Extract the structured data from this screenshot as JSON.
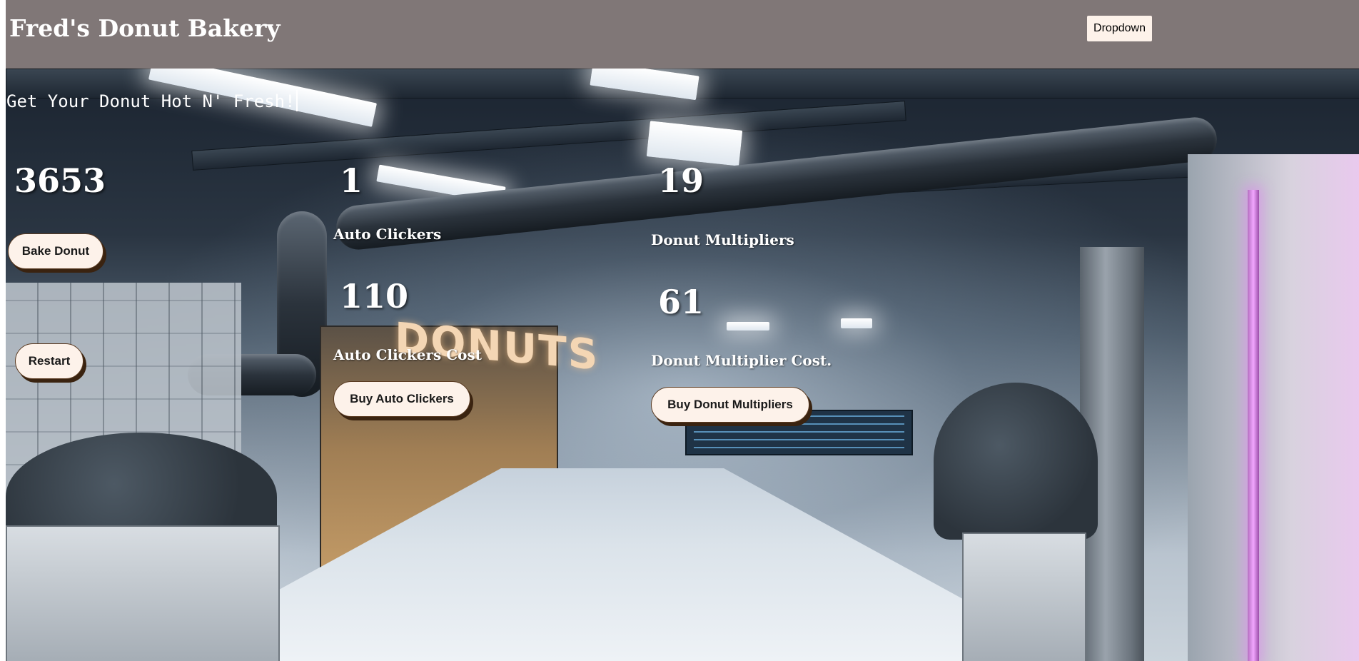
{
  "header": {
    "title": "Fred's Donut Bakery",
    "dropdown_label": "Dropdown"
  },
  "tagline": "Get Your Donut Hot N' Fresh!",
  "donuts": {
    "count": "3653",
    "bake_label": "Bake Donut",
    "restart_label": "Restart"
  },
  "auto_clickers": {
    "count": "1",
    "count_label": "Auto Clickers",
    "cost": "110",
    "cost_label": "Auto Clickers Cost",
    "buy_label": "Buy Auto Clickers"
  },
  "multipliers": {
    "count": "19",
    "count_label": "Donut Multipliers",
    "cost": "61",
    "cost_label": "Donut Multiplier Cost.",
    "buy_label": "Buy Donut Multipliers"
  },
  "scene": {
    "sign_text": "DONUTS"
  },
  "colors": {
    "header_bg": "#807777",
    "button_bg": "#fdf2ea",
    "button_shadow": "#3a2310"
  }
}
